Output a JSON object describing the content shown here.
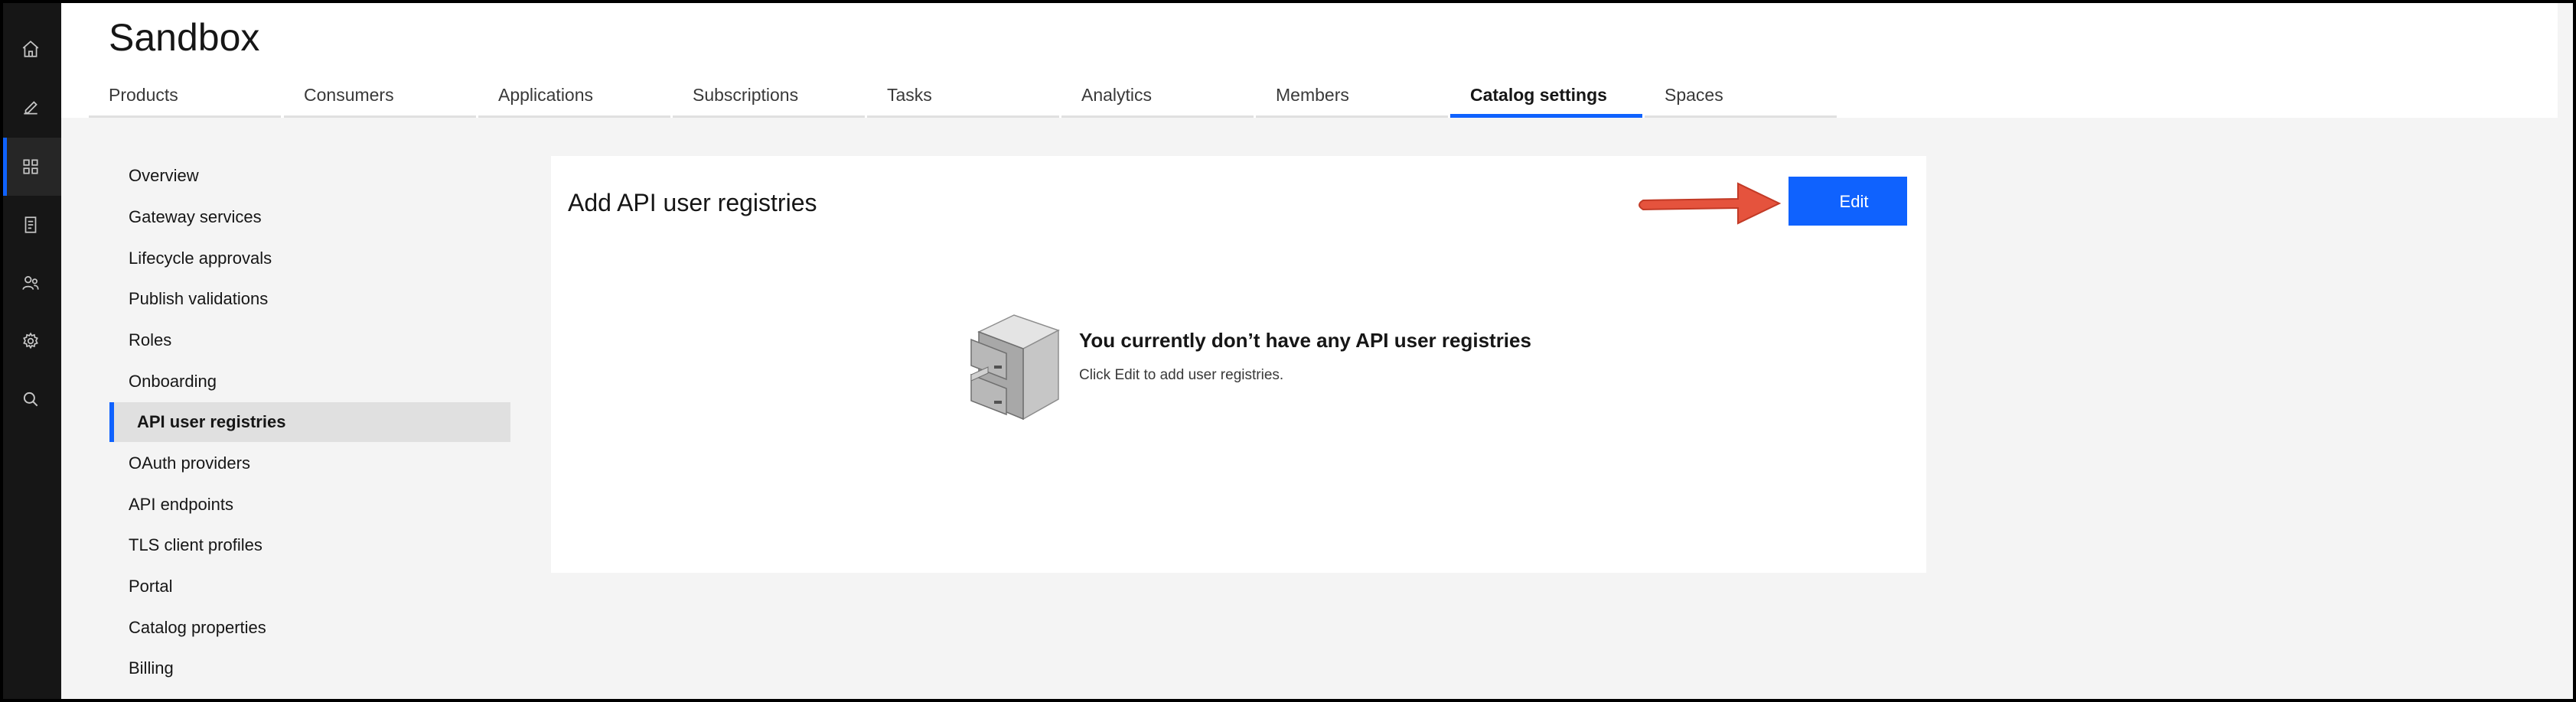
{
  "app": {
    "title": "Sandbox"
  },
  "rail": {
    "items": [
      {
        "icon": "home-icon",
        "active": false
      },
      {
        "icon": "edit-icon",
        "active": false
      },
      {
        "icon": "dashboard-grid-icon",
        "active": true
      },
      {
        "icon": "document-icon",
        "active": false
      },
      {
        "icon": "users-icon",
        "active": false
      },
      {
        "icon": "settings-icon",
        "active": false
      },
      {
        "icon": "search-icon",
        "active": false
      }
    ]
  },
  "tabs": [
    {
      "label": "Products"
    },
    {
      "label": "Consumers"
    },
    {
      "label": "Applications"
    },
    {
      "label": "Subscriptions"
    },
    {
      "label": "Tasks"
    },
    {
      "label": "Analytics"
    },
    {
      "label": "Members"
    },
    {
      "label": "Catalog settings",
      "active": true
    },
    {
      "label": "Spaces"
    }
  ],
  "sidenav": {
    "items": [
      {
        "label": "Overview"
      },
      {
        "label": "Gateway services"
      },
      {
        "label": "Lifecycle approvals"
      },
      {
        "label": "Publish validations"
      },
      {
        "label": "Roles"
      },
      {
        "label": "Onboarding"
      },
      {
        "label": "API user registries",
        "active": true
      },
      {
        "label": "OAuth providers"
      },
      {
        "label": "API endpoints"
      },
      {
        "label": "TLS client profiles"
      },
      {
        "label": "Portal"
      },
      {
        "label": "Catalog properties"
      },
      {
        "label": "Billing"
      }
    ]
  },
  "card": {
    "title": "Add API user registries",
    "edit_label": "Edit",
    "empty_heading": "You currently don’t have any API user registries",
    "empty_sub": "Click Edit to add user registries."
  },
  "colors": {
    "accent": "#0f62fe",
    "arrow": "#e5533d",
    "rail_bg": "#161616",
    "page_bg": "#f4f4f4"
  }
}
